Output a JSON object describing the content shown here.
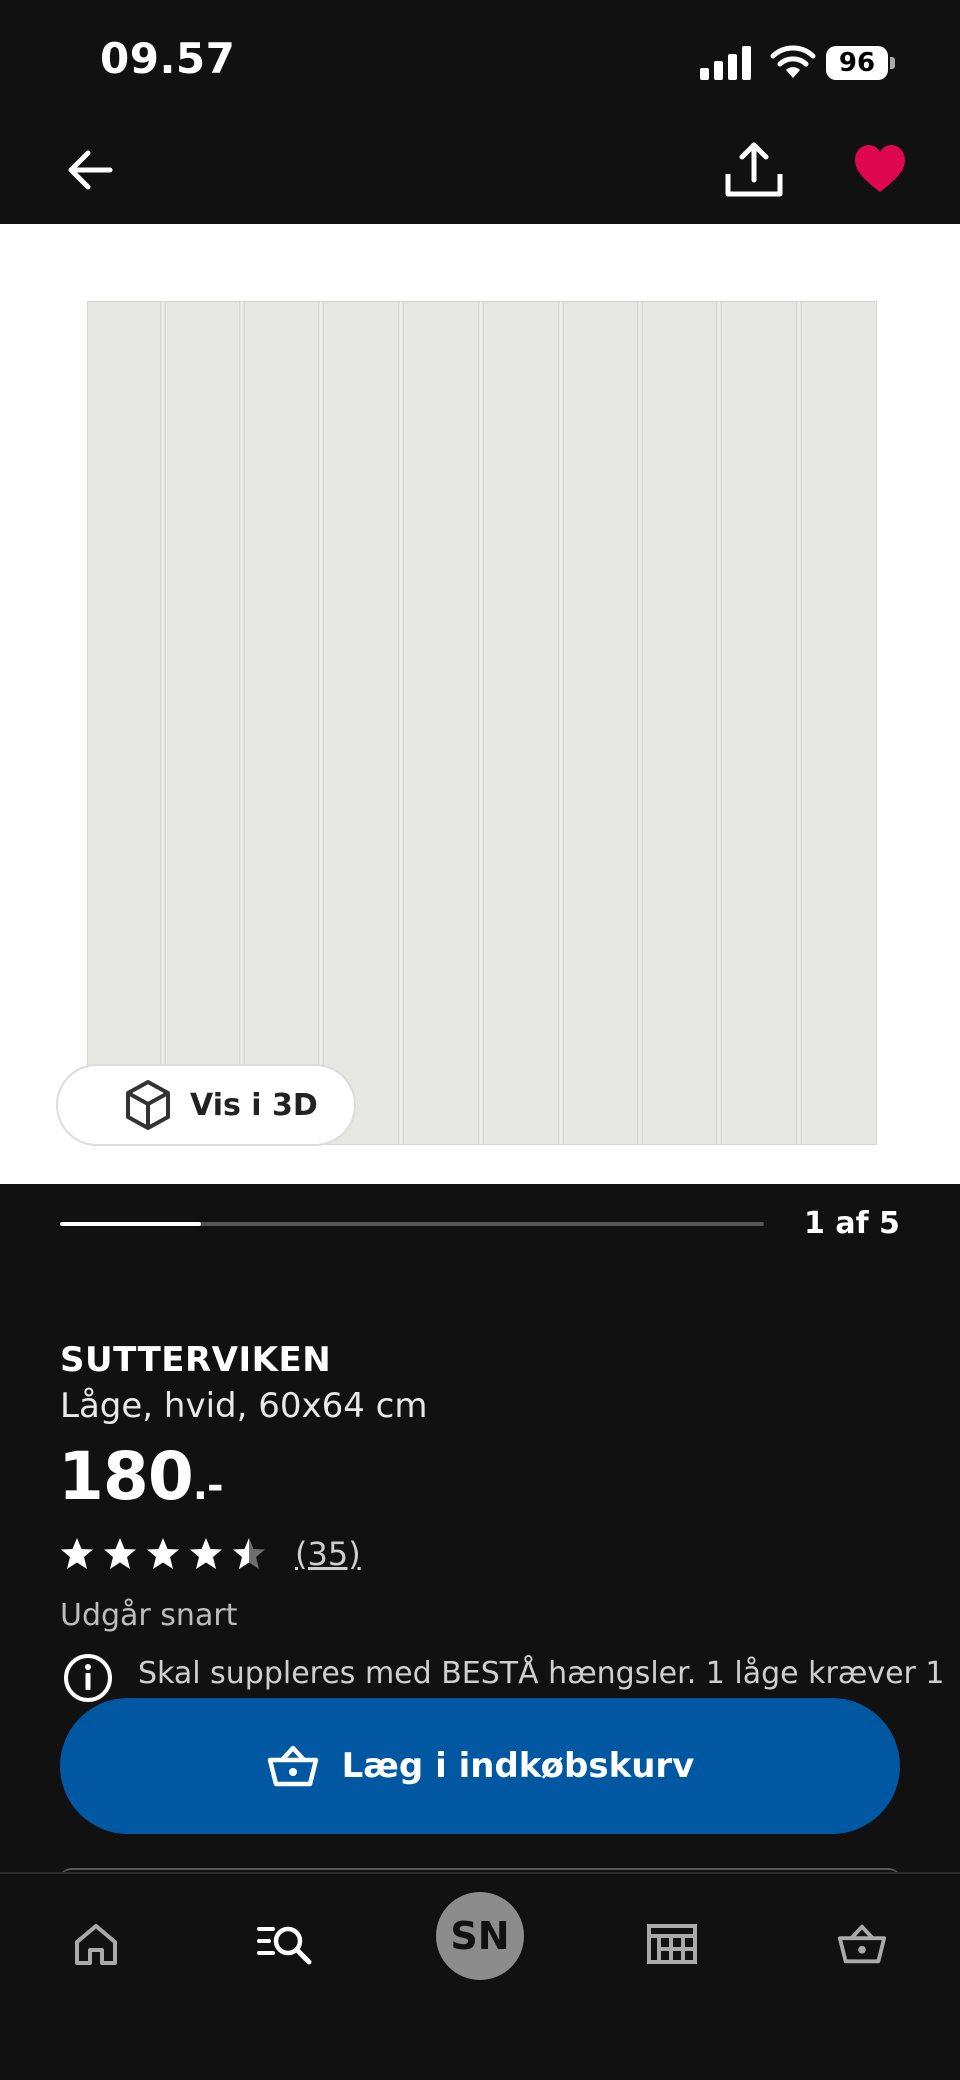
{
  "status_bar": {
    "time": "09.57",
    "battery": "96"
  },
  "header": {
    "back_icon": "arrow-left-icon",
    "share_icon": "share-icon",
    "favorite_icon": "heart-icon",
    "favorite_color": "#e00751"
  },
  "gallery": {
    "view_3d_label": "Vis i 3D",
    "page_indicator": "1 af 5",
    "progress_fraction": 0.2
  },
  "product": {
    "name": "SUTTERVIKEN",
    "description": "Låge, hvid, 60x64 cm",
    "price": "180",
    "price_suffix": ".-",
    "rating": 4.5,
    "review_count": "(35)",
    "status_note": "Udgår snart",
    "info_text": "Skal suppleres med BESTÅ hængsler. 1 låge kræver 1"
  },
  "cart_button": {
    "label": "Læg i indkøbskurv",
    "icon": "basket-icon",
    "color": "#0058a3"
  },
  "bottom_nav": {
    "items": [
      "home-icon",
      "search-list-icon",
      "profile-avatar",
      "store-icon",
      "basket-icon"
    ],
    "avatar_initials": "SN"
  }
}
